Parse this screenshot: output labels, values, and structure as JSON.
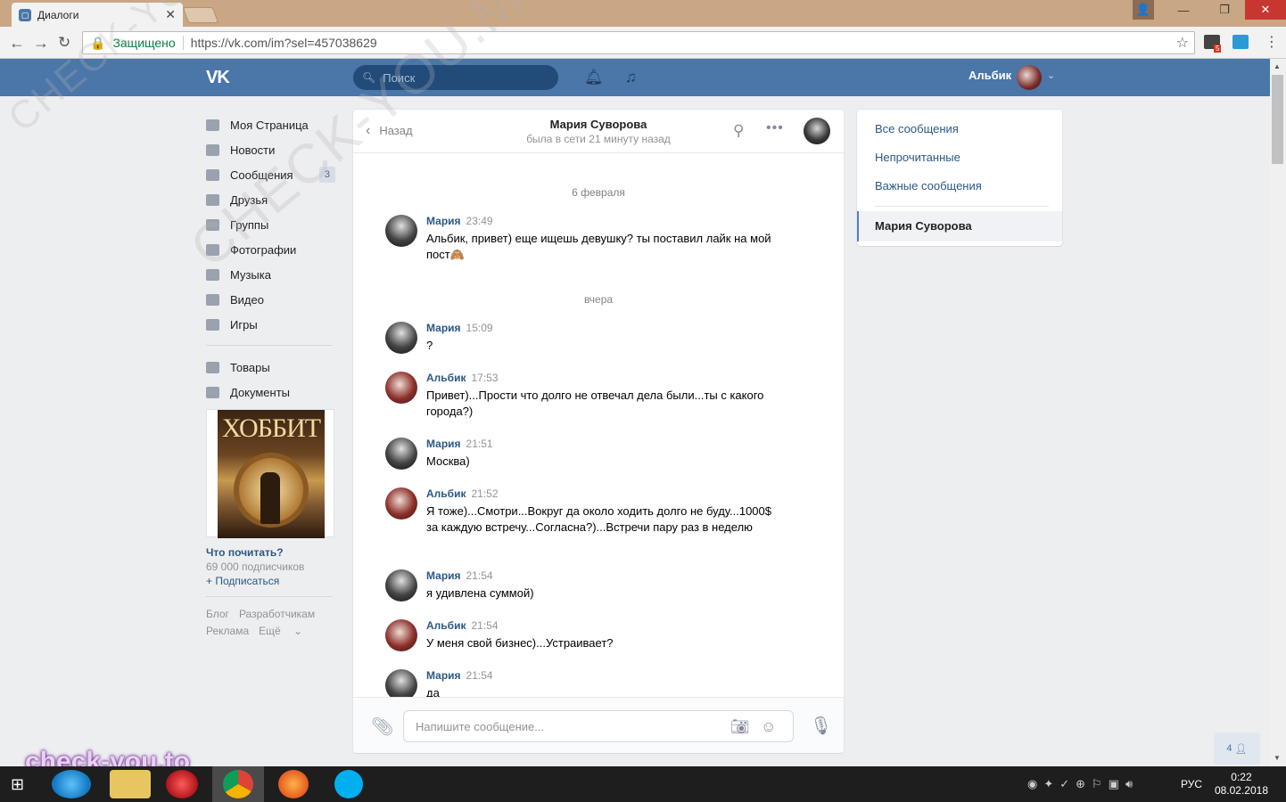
{
  "browser": {
    "tab_title": "Диалоги",
    "secure_label": "Защищено",
    "url": "https://vk.com/im?sel=457038629",
    "ext_badge": "5"
  },
  "header": {
    "logo": "VK",
    "search_placeholder": "Поиск",
    "user_name": "Альбик"
  },
  "sidebar": {
    "items": [
      {
        "label": "Моя Страница",
        "icon": "home-icon"
      },
      {
        "label": "Новости",
        "icon": "news-icon"
      },
      {
        "label": "Сообщения",
        "icon": "messages-icon",
        "count": "3"
      },
      {
        "label": "Друзья",
        "icon": "friends-icon"
      },
      {
        "label": "Группы",
        "icon": "groups-icon"
      },
      {
        "label": "Фотографии",
        "icon": "photos-icon"
      },
      {
        "label": "Музыка",
        "icon": "music-icon"
      },
      {
        "label": "Видео",
        "icon": "video-icon"
      },
      {
        "label": "Игры",
        "icon": "games-icon"
      }
    ],
    "items2": [
      {
        "label": "Товары",
        "icon": "market-icon"
      },
      {
        "label": "Документы",
        "icon": "docs-icon"
      }
    ],
    "ad": {
      "cover_title": "ХОББИТ",
      "title": "Что почитать?",
      "subscribers": "69 000 подписчиков",
      "subscribe": "+ Подписаться"
    },
    "footer": {
      "blog": "Блог",
      "dev": "Разработчикам",
      "ads": "Реклама",
      "more": "Ещё"
    }
  },
  "chat": {
    "back": "Назад",
    "name": "Мария Суворова",
    "status": "была в сети 21 минуту назад",
    "date1": "6 февраля",
    "date2": "вчера",
    "messages": [
      {
        "who": "Мария",
        "time": "23:49",
        "text": "Альбик, привет) еще ищешь девушку? ты поставил лайк на мой пост🙈"
      },
      {
        "who": "Мария",
        "time": "15:09",
        "text": "?"
      },
      {
        "who": "Альбик",
        "time": "17:53",
        "text": "Привет)...Прости что долго не отвечал дела были...ты с какого города?)"
      },
      {
        "who": "Мария",
        "time": "21:51",
        "text": "Москва)"
      },
      {
        "who": "Альбик",
        "time": "21:52",
        "text": "Я тоже)...Смотри...Вокруг да около ходить долго не буду...1000$ за каждую встречу...Согласна?)...Встречи пару раз в неделю"
      },
      {
        "who": "Мария",
        "time": "21:54",
        "text": "я удивлена суммой)"
      },
      {
        "who": "Альбик",
        "time": "21:54",
        "text": "У меня свой бизнес)...Устраивает?"
      },
      {
        "who": "Мария",
        "time": "21:54",
        "text": "да"
      }
    ],
    "input_placeholder": "Напишите сообщение..."
  },
  "right": {
    "all": "Все сообщения",
    "unread": "Непрочитанные",
    "important": "Важные сообщения",
    "selected": "Мария Суворова"
  },
  "online_count": "4",
  "taskbar": {
    "lang": "РУС",
    "time": "0:22",
    "date": "08.02.2018"
  },
  "watermarks": {
    "diagonal": "CHECK-YOU.ME",
    "corner": "check-you.to"
  },
  "colors": {
    "vk_blue": "#4a76a8",
    "link": "#2a5885"
  }
}
